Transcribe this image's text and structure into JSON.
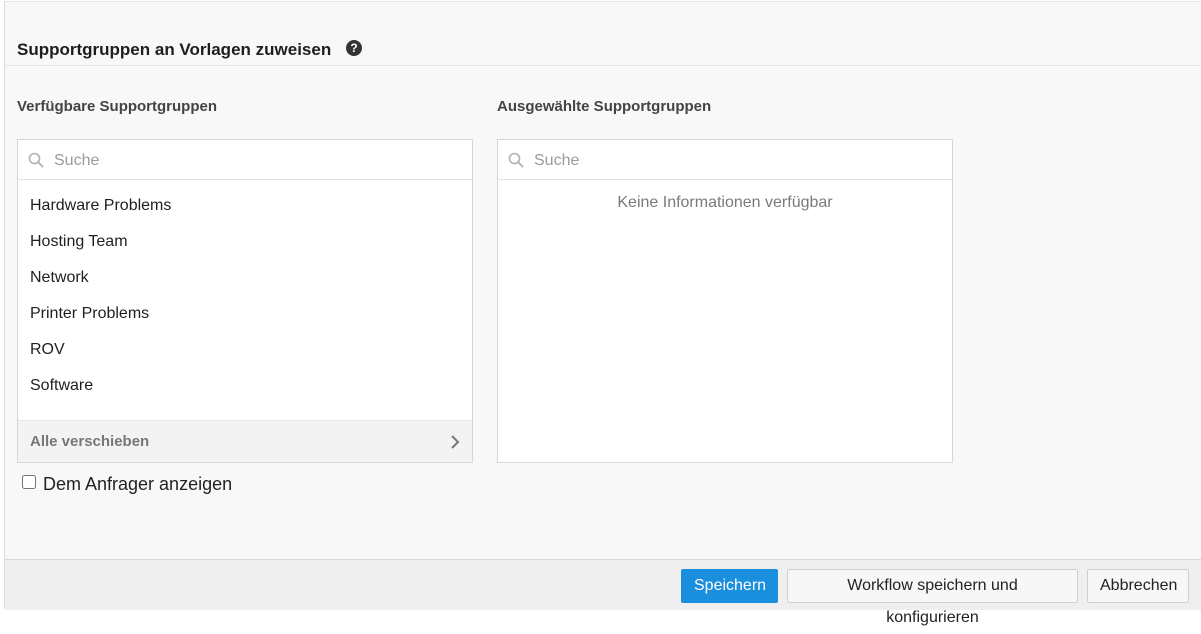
{
  "dialog": {
    "title": "Supportgruppen an Vorlagen zuweisen",
    "help_icon": "?"
  },
  "available": {
    "label": "Verfügbare Supportgruppen",
    "search_placeholder": "Suche",
    "items": [
      "Hardware Problems",
      "Hosting Team",
      "Network",
      "Printer Problems",
      "ROV",
      "Software"
    ],
    "move_all_label": "Alle verschieben"
  },
  "selected": {
    "label": "Ausgewählte Supportgruppen",
    "search_placeholder": "Suche",
    "empty_text": "Keine Informationen verfügbar"
  },
  "options": {
    "show_to_requester_label": "Dem Anfrager anzeigen",
    "show_to_requester_checked": false
  },
  "footer": {
    "save_label": "Speichern",
    "save_configure_label": "Workflow speichern und konfigurieren",
    "cancel_label": "Abbrechen"
  },
  "colors": {
    "primary": "#1a8fdd",
    "background": "#f8f8f8"
  }
}
